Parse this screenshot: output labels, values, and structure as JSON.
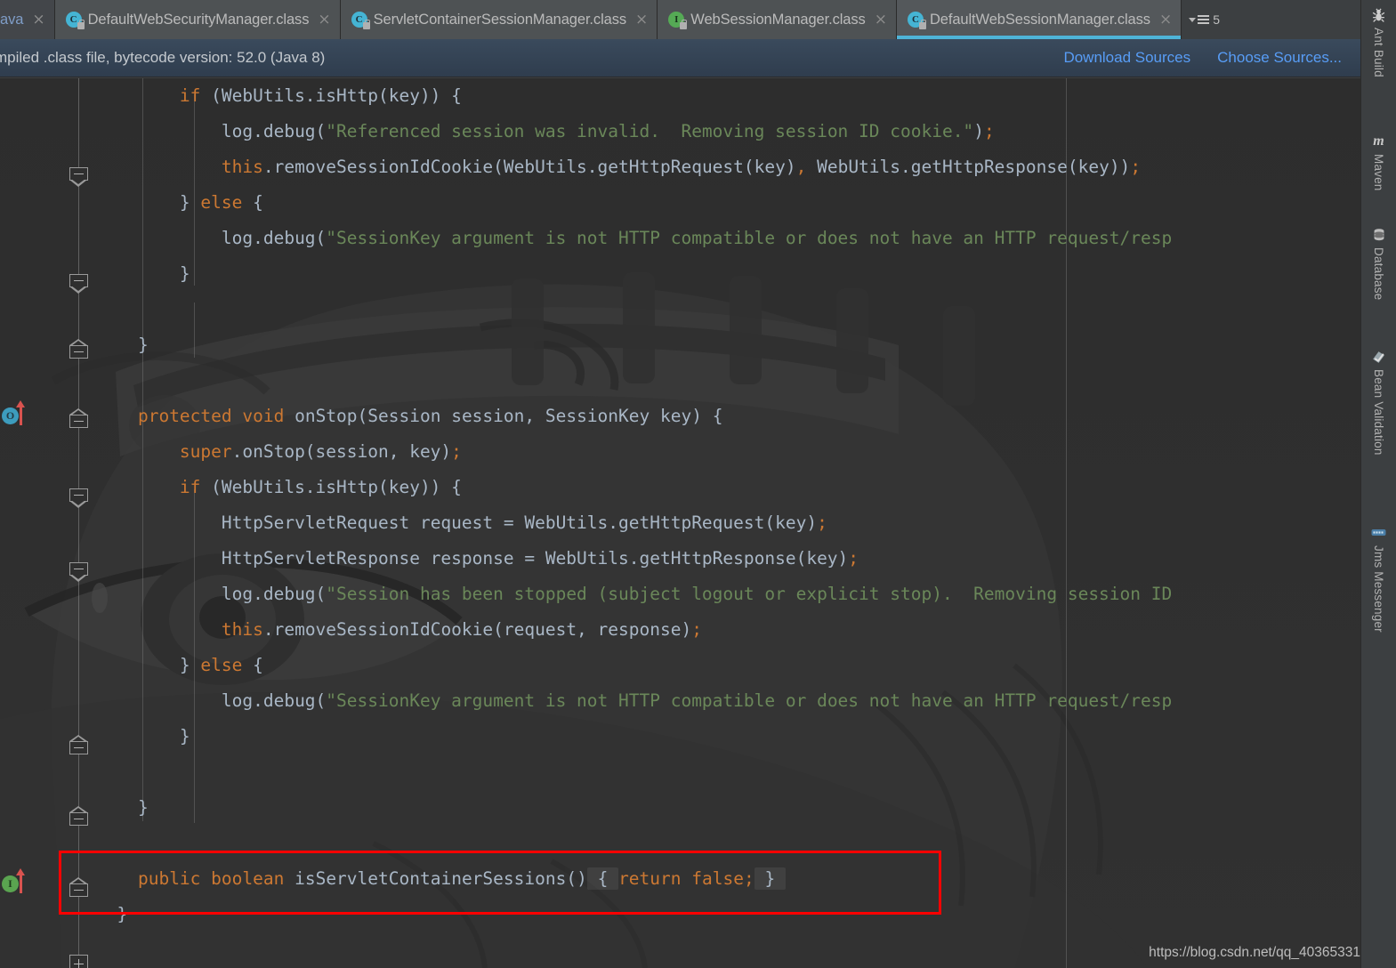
{
  "window": {
    "theme_bg": "#2b2b2b",
    "accent": "#4eb4d8"
  },
  "tabs": {
    "items": [
      {
        "label": "ava",
        "icon": "java-file-icon",
        "active": false,
        "truncated": true
      },
      {
        "label": "DefaultWebSecurityManager.class",
        "icon": "class-file-icon",
        "active": false
      },
      {
        "label": "ServletContainerSessionManager.class",
        "icon": "class-file-icon",
        "active": false
      },
      {
        "label": "WebSessionManager.class",
        "icon": "interface-file-icon",
        "active": false
      },
      {
        "label": "DefaultWebSessionManager.class",
        "icon": "class-file-icon",
        "active": true
      }
    ],
    "overflow_count": "5",
    "close_glyph": "×"
  },
  "notification": {
    "message": "mpiled .class file, bytecode version: 52.0 (Java 8)",
    "actions": [
      {
        "label": "Download Sources"
      },
      {
        "label": "Choose Sources..."
      }
    ],
    "link_color": "#589df6"
  },
  "gutter": {
    "markers": [
      {
        "type": "override-marker",
        "badge": "O",
        "title": "overriding-method-marker"
      },
      {
        "type": "implement-marker",
        "badge": "I",
        "title": "implementing-method-marker"
      }
    ]
  },
  "editor": {
    "language": "java",
    "lines": [
      {
        "indent": 4,
        "tokens": [
          {
            "t": "if",
            "c": "kw"
          },
          {
            "t": " (WebUtils.isHttp(key)) {",
            "c": "pun"
          }
        ]
      },
      {
        "indent": 6,
        "tokens": [
          {
            "t": "log.debug(",
            "c": "pun"
          },
          {
            "t": "\"Referenced session was invalid.  Removing session ID cookie.\"",
            "c": "str"
          },
          {
            "t": ")",
            "c": "pun"
          },
          {
            "t": ";",
            "c": "sem"
          }
        ]
      },
      {
        "indent": 6,
        "tokens": [
          {
            "t": "this",
            "c": "kw"
          },
          {
            "t": ".removeSessionIdCookie(WebUtils.getHttpRequest(key)",
            "c": "pun"
          },
          {
            "t": ",",
            "c": "sem"
          },
          {
            "t": " WebUtils.getHttpResponse(key))",
            "c": "pun"
          },
          {
            "t": ";",
            "c": "sem"
          }
        ]
      },
      {
        "indent": 4,
        "tokens": [
          {
            "t": "} ",
            "c": "pun"
          },
          {
            "t": "else",
            "c": "kw"
          },
          {
            "t": " {",
            "c": "pun"
          }
        ]
      },
      {
        "indent": 6,
        "tokens": [
          {
            "t": "log.debug(",
            "c": "pun"
          },
          {
            "t": "\"SessionKey argument is not HTTP compatible or does not have an HTTP request/resp",
            "c": "str"
          }
        ]
      },
      {
        "indent": 4,
        "tokens": [
          {
            "t": "}",
            "c": "pun"
          }
        ]
      },
      {
        "indent": 0,
        "tokens": []
      },
      {
        "indent": 2,
        "tokens": [
          {
            "t": "}",
            "c": "pun"
          }
        ]
      },
      {
        "indent": 0,
        "tokens": []
      },
      {
        "indent": 2,
        "tokens": [
          {
            "t": "protected",
            "c": "kw"
          },
          {
            "t": " ",
            "c": "pun"
          },
          {
            "t": "void",
            "c": "kw"
          },
          {
            "t": " onStop(Session session, SessionKey key) {",
            "c": "pun"
          }
        ]
      },
      {
        "indent": 4,
        "tokens": [
          {
            "t": "super",
            "c": "kw"
          },
          {
            "t": ".onStop(session, key)",
            "c": "pun"
          },
          {
            "t": ";",
            "c": "sem"
          }
        ]
      },
      {
        "indent": 4,
        "tokens": [
          {
            "t": "if",
            "c": "kw"
          },
          {
            "t": " (WebUtils.isHttp(key)) {",
            "c": "pun"
          }
        ]
      },
      {
        "indent": 6,
        "tokens": [
          {
            "t": "HttpServletRequest request = WebUtils.getHttpRequest(key)",
            "c": "pun"
          },
          {
            "t": ";",
            "c": "sem"
          }
        ]
      },
      {
        "indent": 6,
        "tokens": [
          {
            "t": "HttpServletResponse response = WebUtils.getHttpResponse(key)",
            "c": "pun"
          },
          {
            "t": ";",
            "c": "sem"
          }
        ]
      },
      {
        "indent": 6,
        "tokens": [
          {
            "t": "log.debug(",
            "c": "pun"
          },
          {
            "t": "\"Session has been stopped (subject logout or explicit stop).  Removing session ID",
            "c": "str"
          }
        ]
      },
      {
        "indent": 6,
        "tokens": [
          {
            "t": "this",
            "c": "kw"
          },
          {
            "t": ".removeSessionIdCookie(request, response)",
            "c": "pun"
          },
          {
            "t": ";",
            "c": "sem"
          }
        ]
      },
      {
        "indent": 4,
        "tokens": [
          {
            "t": "} ",
            "c": "pun"
          },
          {
            "t": "else",
            "c": "kw"
          },
          {
            "t": " {",
            "c": "pun"
          }
        ]
      },
      {
        "indent": 6,
        "tokens": [
          {
            "t": "log.debug(",
            "c": "pun"
          },
          {
            "t": "\"SessionKey argument is not HTTP compatible or does not have an HTTP request/resp",
            "c": "str"
          }
        ]
      },
      {
        "indent": 4,
        "tokens": [
          {
            "t": "}",
            "c": "pun"
          }
        ]
      },
      {
        "indent": 0,
        "tokens": []
      },
      {
        "indent": 2,
        "tokens": [
          {
            "t": "}",
            "c": "pun"
          }
        ]
      },
      {
        "indent": 0,
        "tokens": []
      },
      {
        "indent": 2,
        "highlighted": true,
        "tokens": [
          {
            "t": "public",
            "c": "kw"
          },
          {
            "t": " ",
            "c": "pun"
          },
          {
            "t": "boolean",
            "c": "kw"
          },
          {
            "t": " isServletContainerSessions()",
            "c": "pun"
          },
          {
            "t": " { ",
            "c": "chipbrace"
          },
          {
            "t": "return",
            "c": "kw"
          },
          {
            "t": " ",
            "c": "pun"
          },
          {
            "t": "false",
            "c": "kw"
          },
          {
            "t": ";",
            "c": "sem"
          },
          {
            "t": " } ",
            "c": "chipbrace"
          }
        ]
      },
      {
        "indent": 1,
        "tokens": [
          {
            "t": "}",
            "c": "pun"
          }
        ]
      }
    ],
    "highlight_box": {
      "name": "red-annotation-rectangle",
      "color": "#ff0000"
    }
  },
  "tool_windows": [
    {
      "label": "Ant Build",
      "icon": "ant-bug-icon"
    },
    {
      "label": "Maven",
      "icon": "maven-m-icon"
    },
    {
      "label": "Database",
      "icon": "database-cylinder-icon"
    },
    {
      "label": "Bean Validation",
      "icon": "bean-validation-icon"
    },
    {
      "label": "Jms Messenger",
      "icon": "jms-messenger-icon"
    }
  ],
  "marker_stripe": {
    "color": "#0f7a2e",
    "marks": 2
  },
  "watermark": {
    "url": "https://blog.csdn.net/qq_40365331"
  }
}
